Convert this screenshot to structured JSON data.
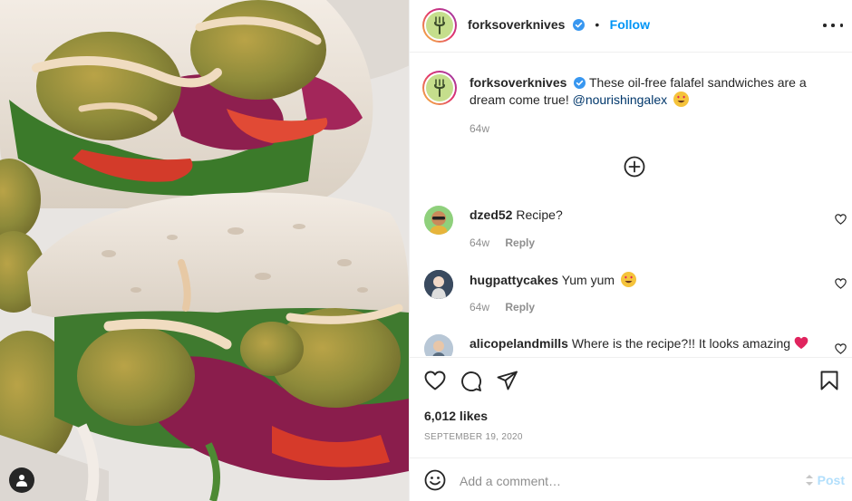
{
  "photo": {
    "alt_icon": "user-tag-icon"
  },
  "header": {
    "username": "forksoverknives",
    "separator": "•",
    "follow_label": "Follow",
    "more_icon": "more-options-icon"
  },
  "caption": {
    "username": "forksoverknives",
    "text": "These oil-free falafel sandwiches are a dream come true!",
    "mention": "@nourishingalex",
    "emoji": "heart-eyes-emoji",
    "time": "64w"
  },
  "load_more_icon": "plus-circle-icon",
  "comments": [
    {
      "username": "dzed52",
      "text": "Recipe?",
      "time": "64w",
      "reply_label": "Reply"
    },
    {
      "username": "hugpattycakes",
      "text": "Yum yum",
      "emoji": "heart-eyes-emoji",
      "time": "64w",
      "reply_label": "Reply"
    },
    {
      "username": "alicopelandmills",
      "text": "Where is the recipe?!! It looks amazing",
      "emoji": "red-heart-emoji"
    }
  ],
  "actions": {
    "like_icon": "heart-icon",
    "comment_icon": "comment-icon",
    "share_icon": "share-icon",
    "save_icon": "bookmark-icon"
  },
  "likes": "6,012 likes",
  "date": "SEPTEMBER 19, 2020",
  "add_comment": {
    "placeholder": "Add a comment…",
    "post_label": "Post"
  },
  "colors": {
    "accent": "#0095f6",
    "link": "#00376b",
    "muted": "#8e8e8e",
    "post_disabled": "#b2dffc",
    "heart_red": "#ed4956"
  }
}
